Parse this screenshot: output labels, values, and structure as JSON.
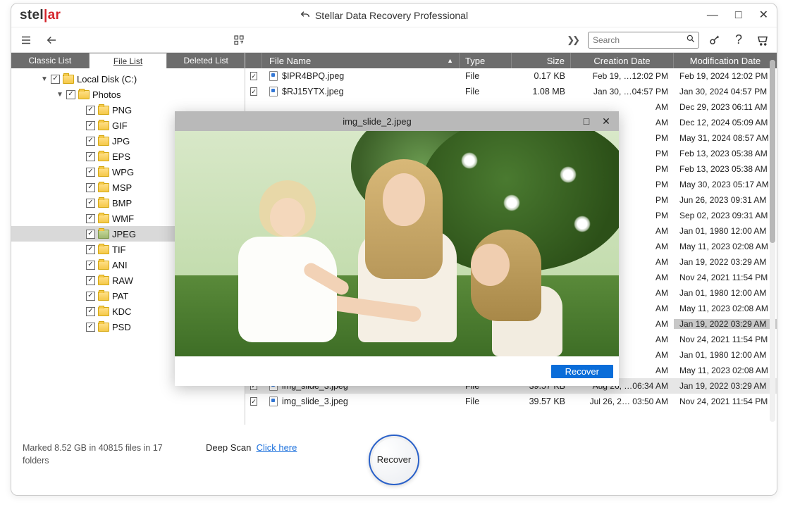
{
  "app": {
    "logo_left": "stel",
    "logo_right": "ar",
    "title": "Stellar Data Recovery Professional"
  },
  "toolbar": {
    "search_placeholder": "Search"
  },
  "sidebar": {
    "tabs": {
      "classic": "Classic List",
      "file": "File List",
      "deleted": "Deleted List"
    },
    "root": "Local Disk (C:)",
    "photos": "Photos",
    "folders": [
      "PNG",
      "GIF",
      "JPG",
      "EPS",
      "WPG",
      "MSP",
      "BMP",
      "WMF",
      "JPEG",
      "TIF",
      "ANI",
      "RAW",
      "PAT",
      "KDC",
      "PSD"
    ],
    "selected": "JPEG"
  },
  "columns": {
    "name": "File Name",
    "type": "Type",
    "size": "Size",
    "created": "Creation Date",
    "modified": "Modification Date"
  },
  "rows": [
    {
      "name": "$IPR4BPQ.jpeg",
      "type": "File",
      "size": "0.17 KB",
      "created": "Feb 19, …12:02 PM",
      "modified": "Feb 19, 2024 12:02 PM"
    },
    {
      "name": "$RJ15YTX.jpeg",
      "type": "File",
      "size": "1.08 MB",
      "created": "Jan 30, …04:57 PM",
      "modified": "Jan 30, 2024 04:57 PM"
    },
    {
      "name": "",
      "type": "",
      "size": "",
      "created": "AM",
      "modified": "Dec 29, 2023 06:11 AM"
    },
    {
      "name": "",
      "type": "",
      "size": "",
      "created": "AM",
      "modified": "Dec 12, 2024 05:09 AM"
    },
    {
      "name": "",
      "type": "",
      "size": "",
      "created": "PM",
      "modified": "May 31, 2024 08:57 AM"
    },
    {
      "name": "",
      "type": "",
      "size": "",
      "created": "PM",
      "modified": "Feb 13, 2023 05:38 AM"
    },
    {
      "name": "",
      "type": "",
      "size": "",
      "created": "PM",
      "modified": "Feb 13, 2023 05:38 AM"
    },
    {
      "name": "",
      "type": "",
      "size": "",
      "created": "PM",
      "modified": "May 30, 2023 05:17 AM"
    },
    {
      "name": "",
      "type": "",
      "size": "",
      "created": "PM",
      "modified": "Jun 26, 2023 09:31 AM"
    },
    {
      "name": "",
      "type": "",
      "size": "",
      "created": "PM",
      "modified": "Sep 02, 2023 09:31 AM"
    },
    {
      "name": "",
      "type": "",
      "size": "",
      "created": "AM",
      "modified": "Jan 01, 1980 12:00 AM"
    },
    {
      "name": "",
      "type": "",
      "size": "",
      "created": "AM",
      "modified": "May 11, 2023 02:08 AM"
    },
    {
      "name": "",
      "type": "",
      "size": "",
      "created": "AM",
      "modified": "Jan 19, 2022 03:29 AM"
    },
    {
      "name": "",
      "type": "",
      "size": "",
      "created": "AM",
      "modified": "Nov 24, 2021 11:54 PM"
    },
    {
      "name": "",
      "type": "",
      "size": "",
      "created": "AM",
      "modified": "Jan 01, 1980 12:00 AM"
    },
    {
      "name": "",
      "type": "",
      "size": "",
      "created": "AM",
      "modified": "May 11, 2023 02:08 AM"
    },
    {
      "name": "",
      "type": "",
      "size": "",
      "created": "AM",
      "modified": "Jan 19, 2022 03:29 AM",
      "sel": true
    },
    {
      "name": "",
      "type": "",
      "size": "",
      "created": "AM",
      "modified": "Nov 24, 2021 11:54 PM"
    },
    {
      "name": "",
      "type": "",
      "size": "",
      "created": "AM",
      "modified": "Jan 01, 1980 12:00 AM"
    },
    {
      "name": "",
      "type": "",
      "size": "",
      "created": "AM",
      "modified": "May 11, 2023 02:08 AM"
    },
    {
      "name": "img_slide_3.jpeg",
      "type": "File",
      "size": "39.57 KB",
      "created": "Aug 26, …06:34 AM",
      "modified": "Jan 19, 2022 03:29 AM",
      "hover": true
    },
    {
      "name": "img_slide_3.jpeg",
      "type": "File",
      "size": "39.57 KB",
      "created": "Jul 26, 2… 03:50 AM",
      "modified": "Nov 24, 2021 11:54 PM"
    }
  ],
  "preview": {
    "title": "img_slide_2.jpeg",
    "recover": "Recover"
  },
  "footer": {
    "marked": "Marked 8.52 GB in 40815 files in 17 folders",
    "deepscan_label": "Deep Scan",
    "deepscan_link": "Click here",
    "recover": "Recover"
  }
}
